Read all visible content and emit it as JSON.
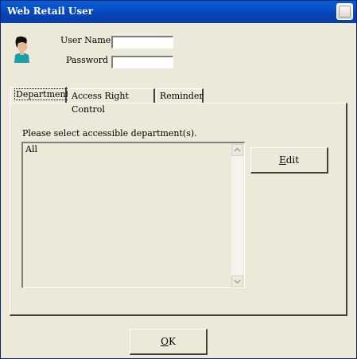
{
  "window": {
    "title": "Web Retail User"
  },
  "form": {
    "user_name_label": "User Name :",
    "user_name_value": "",
    "password_label": "Password :",
    "password_value": ""
  },
  "tabs": [
    {
      "label": "Department",
      "active": true
    },
    {
      "label": "Access Right Control",
      "active": false
    },
    {
      "label": "Reminder",
      "active": false
    }
  ],
  "department_panel": {
    "instruction": "Please select accessible department(s).",
    "list_items": [
      "All"
    ],
    "edit_button": {
      "label_pre": "",
      "mnemonic": "E",
      "label_post": "dit"
    }
  },
  "ok_button": {
    "mnemonic": "O",
    "label_post": "K"
  },
  "icons": {
    "avatar": "user-avatar-icon",
    "close": "close-icon"
  }
}
